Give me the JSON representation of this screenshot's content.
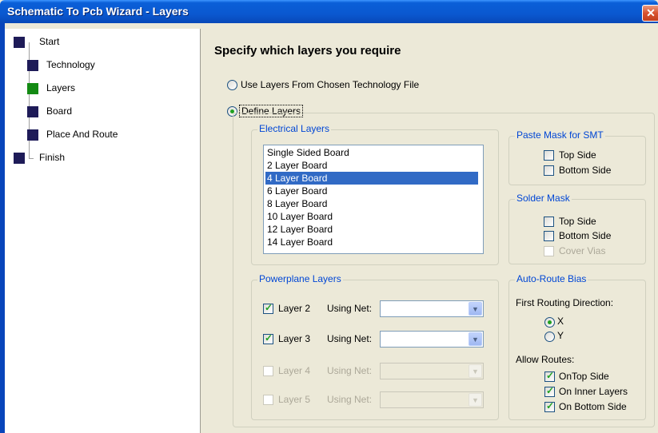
{
  "window": {
    "title": "Schematic To Pcb Wizard - Layers",
    "close_icon": "close-icon"
  },
  "tree": {
    "items": [
      {
        "label": "Start",
        "color": "#1e1b58"
      },
      {
        "label": "Technology",
        "color": "#1e1b58"
      },
      {
        "label": "Layers",
        "color": "#138a13"
      },
      {
        "label": "Board",
        "color": "#1e1b58"
      },
      {
        "label": "Place And Route",
        "color": "#1e1b58"
      },
      {
        "label": "Finish",
        "color": "#1e1b58"
      }
    ]
  },
  "main": {
    "heading": "Specify which layers you require",
    "radio_tech_file": "Use Layers From Chosen Technology File",
    "radio_define": "Define Layers",
    "electrical": {
      "title": "Electrical Layers",
      "items": [
        "Single Sided Board",
        "2 Layer Board",
        "4 Layer Board",
        "6 Layer Board",
        "8 Layer Board",
        "10 Layer Board",
        "12 Layer Board",
        "14 Layer Board"
      ],
      "selected": "4 Layer Board"
    },
    "paste_mask": {
      "title": "Paste Mask for SMT",
      "top": "Top Side",
      "bottom": "Bottom Side"
    },
    "solder_mask": {
      "title": "Solder Mask",
      "top": "Top Side",
      "bottom": "Bottom Side",
      "cover_vias": "Cover Vias"
    },
    "powerplane": {
      "title": "Powerplane Layers",
      "using_net": "Using Net:",
      "layers": [
        {
          "label": "Layer 2",
          "checked": true,
          "enabled": true
        },
        {
          "label": "Layer 3",
          "checked": true,
          "enabled": true
        },
        {
          "label": "Layer 4",
          "checked": false,
          "enabled": false
        },
        {
          "label": "Layer 5",
          "checked": false,
          "enabled": false
        }
      ]
    },
    "autoroute": {
      "title": "Auto-Route Bias",
      "first_dir": "First Routing Direction:",
      "x": "X",
      "y": "Y",
      "allow": "Allow Routes:",
      "ontop": "OnTop Side",
      "inner": "On Inner Layers",
      "bottom": "On Bottom Side"
    }
  }
}
